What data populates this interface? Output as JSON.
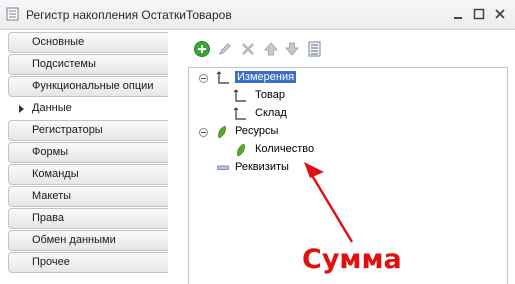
{
  "window": {
    "title": "Регистр накопления ОстаткиТоваров",
    "minimize_glyph": "_",
    "maximize_glyph": "□",
    "close_glyph": "×"
  },
  "nav": {
    "items": [
      {
        "label": "Основные"
      },
      {
        "label": "Подсистемы"
      },
      {
        "label": "Функциональные опции"
      },
      {
        "label": "Данные",
        "active": true
      },
      {
        "label": "Регистраторы"
      },
      {
        "label": "Формы"
      },
      {
        "label": "Команды"
      },
      {
        "label": "Макеты"
      },
      {
        "label": "Права"
      },
      {
        "label": "Обмен данными"
      },
      {
        "label": "Прочее"
      }
    ]
  },
  "toolbar": {
    "buttons": [
      "add-icon",
      "edit-icon",
      "delete-icon",
      "move-up-icon",
      "move-down-icon",
      "list-icon"
    ]
  },
  "tree": {
    "dimensions": {
      "label": "Измерения",
      "children": [
        "Товар",
        "Склад"
      ]
    },
    "resources": {
      "label": "Ресурсы",
      "children": [
        "Количество"
      ]
    },
    "attributes": {
      "label": "Реквизиты"
    }
  },
  "annotation": {
    "text": "Сумма",
    "color": "#e01010"
  },
  "colors": {
    "selection": "#3a6fc9",
    "add_green": "#3aa53a",
    "resource_green": "#5aa82a"
  }
}
